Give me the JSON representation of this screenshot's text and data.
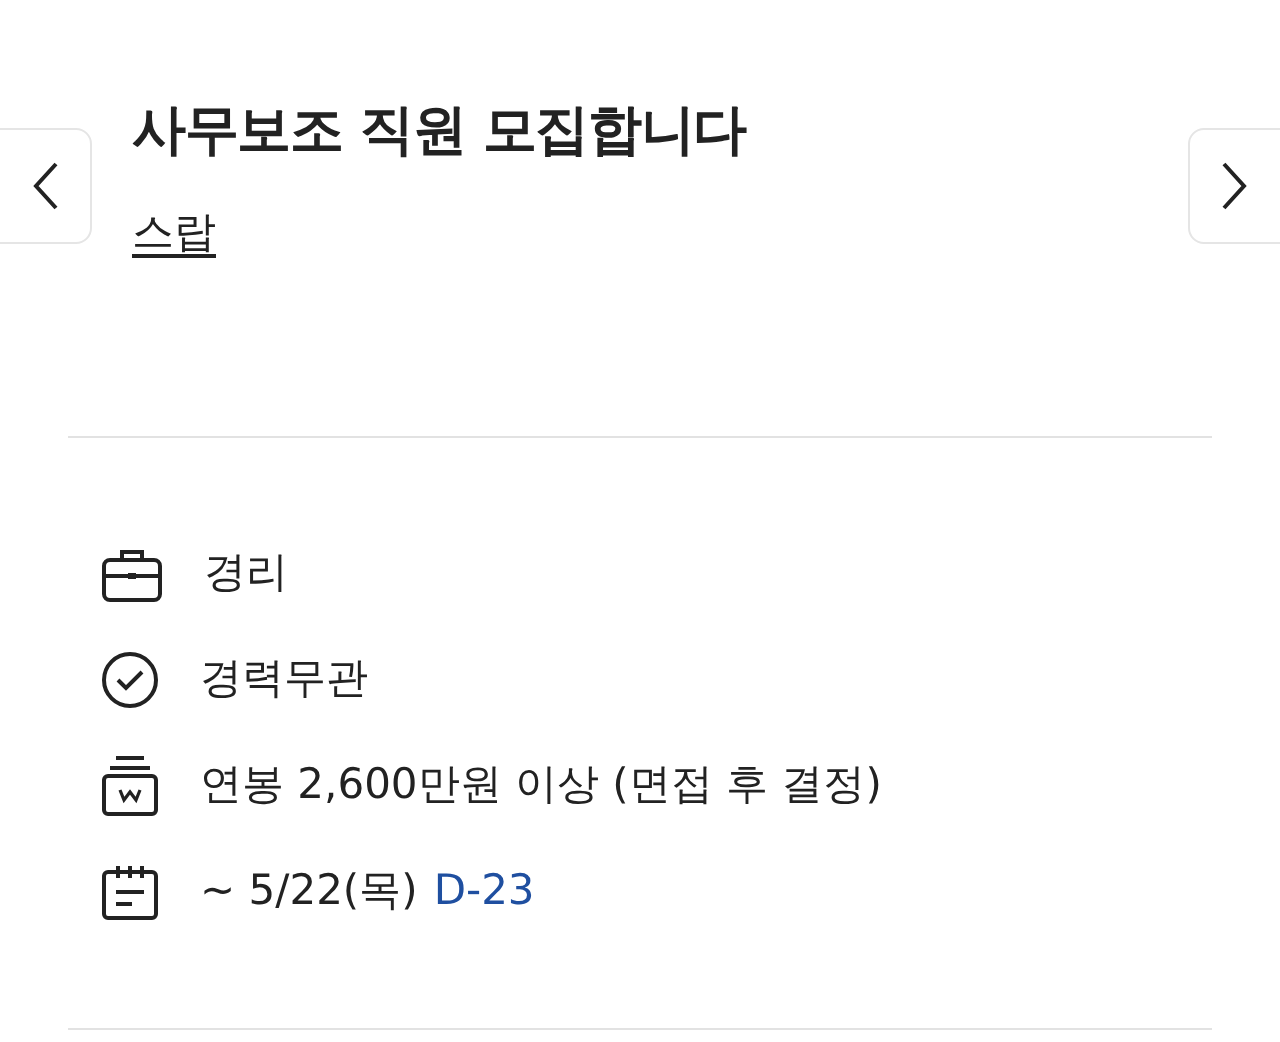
{
  "title": "사무보조 직원 모집합니다",
  "company": "스랍",
  "details": [
    {
      "kind": "job",
      "text": "경리"
    },
    {
      "kind": "career",
      "text": "경력무관"
    },
    {
      "kind": "salary",
      "text": "연봉 2,600만원 이상 (면접 후 결정)"
    },
    {
      "kind": "deadline",
      "text": "~ 5/22(목)",
      "dday": "D-23"
    }
  ]
}
